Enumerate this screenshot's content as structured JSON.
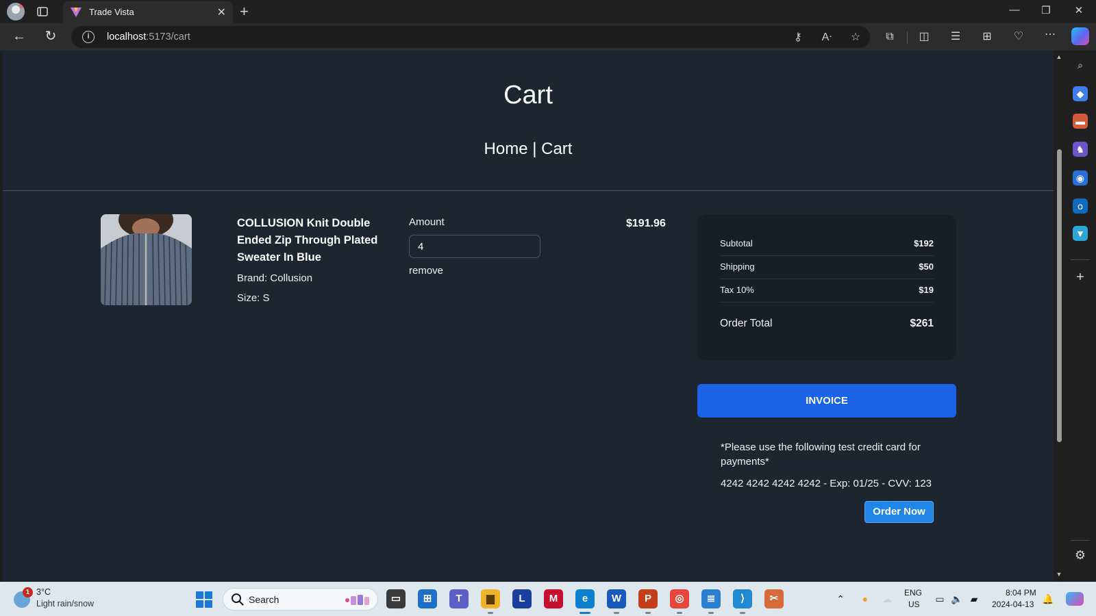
{
  "browser": {
    "tab_title": "Trade Vista",
    "url_host": "localhost",
    "url_rest": ":5173/cart"
  },
  "page": {
    "title": "Cart",
    "breadcrumb": "Home | Cart"
  },
  "cart_item": {
    "name": "COLLUSION Knit Double Ended Zip Through Plated Sweater In Blue",
    "brand": "Brand: Collusion",
    "size": "Size: S",
    "amount_label": "Amount",
    "amount_value": "4",
    "remove_label": "remove",
    "line_price": "$191.96"
  },
  "summary": {
    "subtotal_label": "Subtotal",
    "subtotal_value": "$192",
    "shipping_label": "Shipping",
    "shipping_value": "$50",
    "tax_label": "Tax 10%",
    "tax_value": "$19",
    "total_label": "Order Total",
    "total_value": "$261"
  },
  "actions": {
    "invoice_label": "INVOICE",
    "note": "*Please use the following test credit card for payments*",
    "card_info": "4242 4242 4242 4242 - Exp: 01/25 - CVV: 123",
    "order_label": "Order Now"
  },
  "taskbar": {
    "weather_badge": "1",
    "weather_temp": "3°C",
    "weather_desc": "Light rain/snow",
    "search_placeholder": "Search",
    "lang_top": "ENG",
    "lang_bottom": "US",
    "time": "8:04 PM",
    "date": "2024-04-13"
  },
  "colors": {
    "page_bg": "#1d2531",
    "summary_bg": "#181e28",
    "invoice_button": "#1b63e6",
    "order_button": "#1f86e8"
  },
  "icons": [
    "profile-icon",
    "tabs-icon",
    "favicon-icon",
    "close-icon",
    "back-icon",
    "refresh-icon",
    "info-icon",
    "key-icon",
    "read-aloud-icon",
    "star-icon",
    "extensions-icon",
    "split-screen-icon",
    "favorites-icon",
    "collections-icon",
    "performance-icon",
    "more-icon",
    "search-icon",
    "settings-icon",
    "plus-icon"
  ]
}
